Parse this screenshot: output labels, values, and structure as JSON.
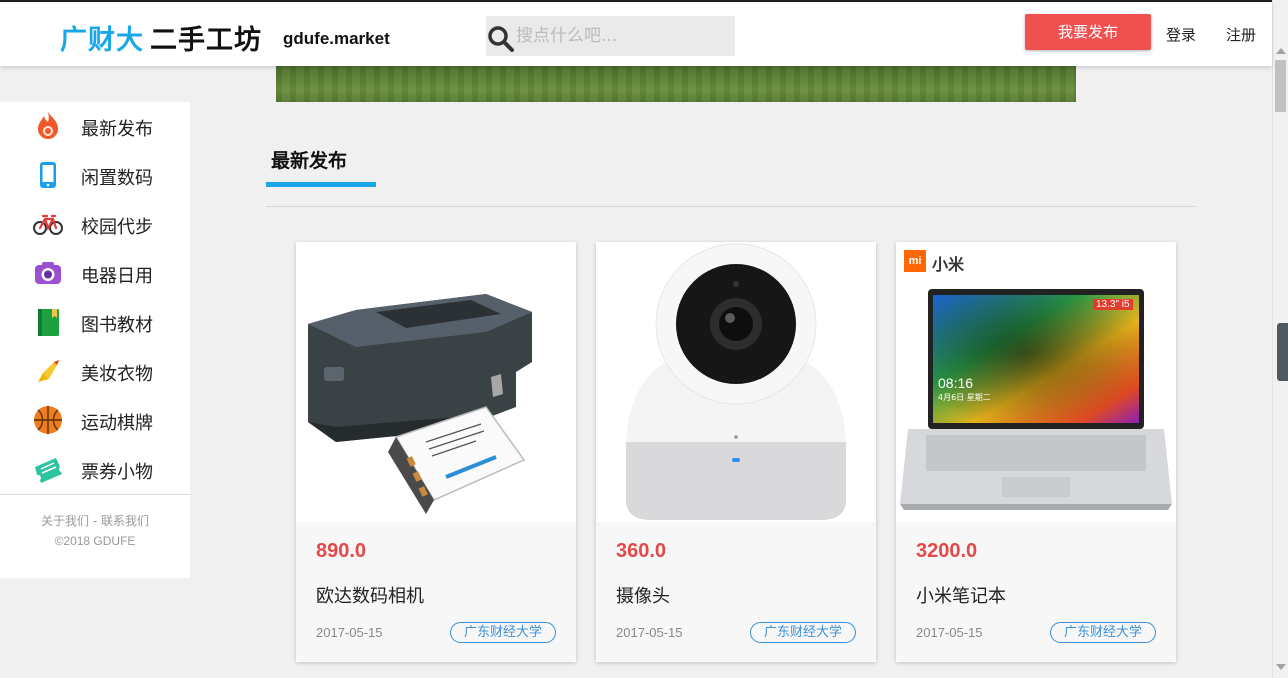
{
  "header": {
    "logo_part1": "广财大",
    "logo_part2": "二手工坊",
    "domain": "gdufe.market",
    "search_placeholder": "搜点什么吧...",
    "publish_label": "我要发布",
    "login_label": "登录",
    "register_label": "注册"
  },
  "sidebar": {
    "items": [
      {
        "label": "最新发布",
        "icon": "fire-icon"
      },
      {
        "label": "闲置数码",
        "icon": "phone-icon"
      },
      {
        "label": "校园代步",
        "icon": "bicycle-icon"
      },
      {
        "label": "电器日用",
        "icon": "camera-icon"
      },
      {
        "label": "图书教材",
        "icon": "book-icon"
      },
      {
        "label": "美妆衣物",
        "icon": "lipstick-icon"
      },
      {
        "label": "运动棋牌",
        "icon": "basketball-icon"
      },
      {
        "label": "票券小物",
        "icon": "ticket-icon"
      }
    ],
    "footer_links": "关于我们 - 联系我们",
    "copyright": "©2018 GDUFE"
  },
  "section": {
    "title": "最新发布"
  },
  "products": [
    {
      "price": "890.0",
      "name": "欧达数码相机",
      "date": "2017-05-15",
      "tag": "广东财经大学",
      "image": "battery-charger-image"
    },
    {
      "price": "360.0",
      "name": "摄像头",
      "date": "2017-05-15",
      "tag": "广东财经大学",
      "image": "webcam-image"
    },
    {
      "price": "3200.0",
      "name": "小米笔记本",
      "date": "2017-05-15",
      "tag": "广东财经大学",
      "image": "laptop-image",
      "brand_label": "小米",
      "screen_badge": "13.3\" i5",
      "screen_time": "08:16",
      "screen_date": "4月6日 星期二"
    }
  ],
  "colors": {
    "brand_blue": "#1aa7e8",
    "accent_red": "#ef5151",
    "price_red": "#e24a4a",
    "tag_blue": "#3b8fd8"
  }
}
